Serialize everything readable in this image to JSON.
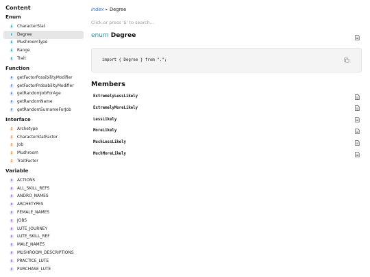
{
  "sidebar": {
    "title": "Content",
    "groups": [
      {
        "heading": "Enum",
        "kind": "E",
        "items": [
          "CharacterStat",
          "Degree",
          "MushroomType",
          "Range",
          "Trait"
        ],
        "active_index": 1
      },
      {
        "heading": "Function",
        "kind": "F",
        "items": [
          "getFactorPossibilityModifier",
          "getFactorProbabilityModifier",
          "getRandomJobForAge",
          "getRandomName",
          "getRandomSurnameForJob"
        ],
        "active_index": -1
      },
      {
        "heading": "Interface",
        "kind": "I",
        "items": [
          "Archetype",
          "CharacterStatFactor",
          "Job",
          "Mushroom",
          "TraitFactor"
        ],
        "active_index": -1
      },
      {
        "heading": "Variable",
        "kind": "V",
        "items": [
          "ACTIONS",
          "ALL_SKILL_REFS",
          "ANDRO_NAMES",
          "ARCHETYPES",
          "FEMALE_NAMES",
          "JOBS",
          "LUTE_JOURNEY",
          "LUTE_SKILL_REF",
          "MALE_NAMES",
          "MUSHROOM_DESCRIPTIONS",
          "PRACTICE_LUTE",
          "PURCHASE_LUTE"
        ],
        "active_index": -1
      }
    ]
  },
  "breadcrumb": {
    "root": "index",
    "separator": "▸",
    "current": "Degree"
  },
  "search": {
    "placeholder": "Click or press 'S' to search..."
  },
  "header": {
    "keyword": "enum",
    "name": "Degree"
  },
  "code": {
    "text": "import { Degree } from \".\";"
  },
  "members": {
    "title": "Members",
    "items": [
      "ExtremelyLessLikely",
      "ExtremelyMoreLikely",
      "LessLikely",
      "MoreLikely",
      "MuchLessLikely",
      "MuchMoreLikely"
    ]
  },
  "colors": {
    "link": "#2a6fd6",
    "enum_keyword": "#1e96ab",
    "active_bg": "#e6e6e6"
  },
  "icons": {
    "doc": "document-icon",
    "copy": "copy-icon"
  }
}
